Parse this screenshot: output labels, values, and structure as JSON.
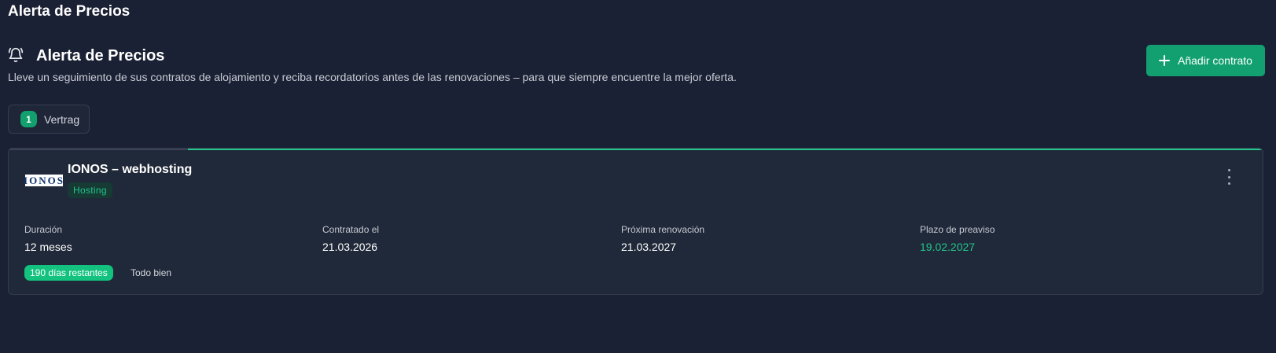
{
  "page": {
    "title": "Alerta de Precios"
  },
  "header": {
    "icon": "bell-icon",
    "title": "Alerta de Precios",
    "subtitle": "Lleve un seguimiento de sus contratos de alojamiento y reciba recordatorios antes de las renovaciones – para que siempre encuentre la mejor oferta.",
    "add_button_label": "Añadir contrato",
    "add_button_icon": "plus-icon"
  },
  "filter": {
    "count": "1",
    "label": "Vertrag"
  },
  "contracts": [
    {
      "logo_text": "IONOS",
      "title": "IONOS – webhosting",
      "tag": "Hosting",
      "fields": [
        {
          "label": "Duración",
          "value": "12 meses"
        },
        {
          "label": "Contratado el",
          "value": "21.03.2026"
        },
        {
          "label": "Próxima renovación",
          "value": "21.03.2027"
        },
        {
          "label": "Plazo de preaviso",
          "value": "19.02.2027"
        }
      ],
      "days_remaining": "190 días restantes",
      "status": "Todo bien"
    }
  ],
  "colors": {
    "background": "#1b2134",
    "card": "#202939",
    "accent": "#12a070",
    "success": "#22c48a"
  }
}
